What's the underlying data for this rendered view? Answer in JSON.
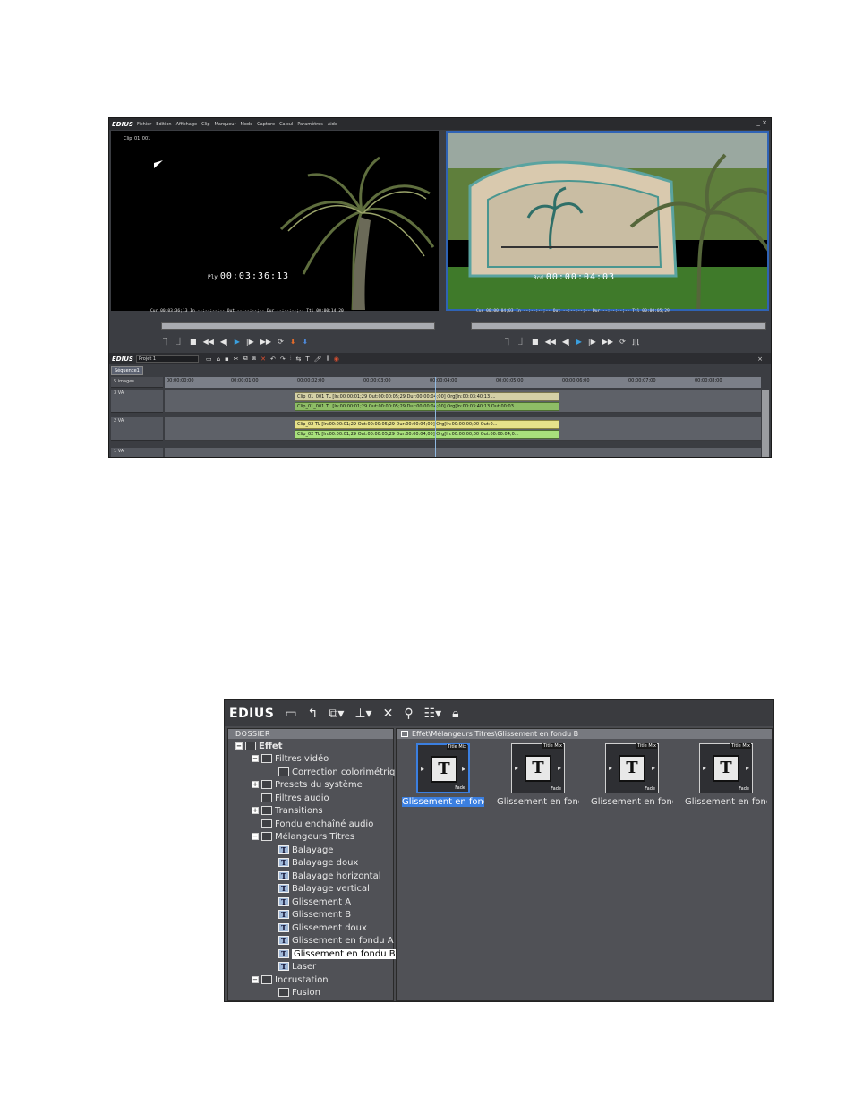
{
  "main_window": {
    "app_name": "EDIUS",
    "menu": [
      "Fichier",
      "Edition",
      "Affichage",
      "Clip",
      "Marqueur",
      "Mode",
      "Capture",
      "Calcul",
      "Paramètres",
      "Aide"
    ],
    "window_controls": "_ ×",
    "player": {
      "clip_name": "Clip_01_001",
      "tc_label": "Ply",
      "timecode": "00:03:36:13",
      "status": "Cur 00:03:36;13   In --:--:--;--   Out --:--:--;--   Dur --:--:--;--   Ttl 00:00:14;20"
    },
    "recorder": {
      "tc_label": "Rcd",
      "timecode": "00:00:04:03",
      "status": "Cur 00:00:04;03   In --:--:--;--   Out --:--:--;--   Dur --:--:--;--   Ttl 00:00:05;29"
    },
    "timeline": {
      "app_name": "EDIUS",
      "project_name": "Projet 1",
      "sequence_tab": "Séquence1",
      "zoom_label": "5 images",
      "ruler_ticks": [
        "00:00:00;00",
        "00:00:01;00",
        "00:00:02;00",
        "00:00:03;00",
        "00:00:04;00",
        "00:00:05;00",
        "00:00:06;00",
        "00:00:07;00",
        "00:00:08;00"
      ],
      "tracks": [
        {
          "name": "3 VA"
        },
        {
          "name": "2 VA"
        },
        {
          "name": "1 VA"
        }
      ],
      "clips": {
        "v3": "Clip_01_001  TL [In:00:00:01;29 Out:00:00:05;29 Dur:00:00:04;00]  Org[In:00:03:40;13 ...",
        "a3": "Clip_01_001  TL [In:00:00:01;29 Out:00:00:05;29 Dur:00:00:04;00]  Org[In:00:03:40;13 Out:00:03...",
        "v2": "Clip_02  TL [In:00:00:01;29 Out:00:00:05;29 Dur:00:00:04;00]  Org[In:00:00:00;00 Out:0...",
        "a2": "Clip_02  TL [In:00:00:01;29 Out:00:00:05;29 Dur:00:00:04;00]  Org[In:00:00:00;00 Out:00:00:04;0..."
      }
    }
  },
  "effect_palette": {
    "app_name": "EDIUS",
    "folder_header": "DOSSIER",
    "path": "Effet\\Mélangeurs Titres\\Glissement en fondu B",
    "tree": [
      {
        "label": "Effet"
      },
      {
        "label": "Filtres vidéo"
      },
      {
        "label": "Correction colorimétrique"
      },
      {
        "label": "Presets du système"
      },
      {
        "label": "Filtres audio"
      },
      {
        "label": "Transitions"
      },
      {
        "label": "Fondu enchaîné audio"
      },
      {
        "label": "Mélangeurs Titres"
      },
      {
        "label": "Balayage"
      },
      {
        "label": "Balayage doux"
      },
      {
        "label": "Balayage horizontal"
      },
      {
        "label": "Balayage vertical"
      },
      {
        "label": "Glissement A"
      },
      {
        "label": "Glissement B"
      },
      {
        "label": "Glissement doux"
      },
      {
        "label": "Glissement en fondu A"
      },
      {
        "label": "Glissement en fondu B"
      },
      {
        "label": "Laser"
      },
      {
        "label": "Incrustation"
      },
      {
        "label": "Fusion"
      }
    ],
    "effects": [
      {
        "label": "Glissement en fond...",
        "badge": "Title Mix",
        "fade": "Fade"
      },
      {
        "label": "Glissement en fond...",
        "badge": "Title Mix",
        "fade": "Fade"
      },
      {
        "label": "Glissement en fond...",
        "badge": "Title Mix",
        "fade": "Fade"
      },
      {
        "label": "Glissement en fond...",
        "badge": "Title Mix",
        "fade": "Fade"
      }
    ]
  }
}
